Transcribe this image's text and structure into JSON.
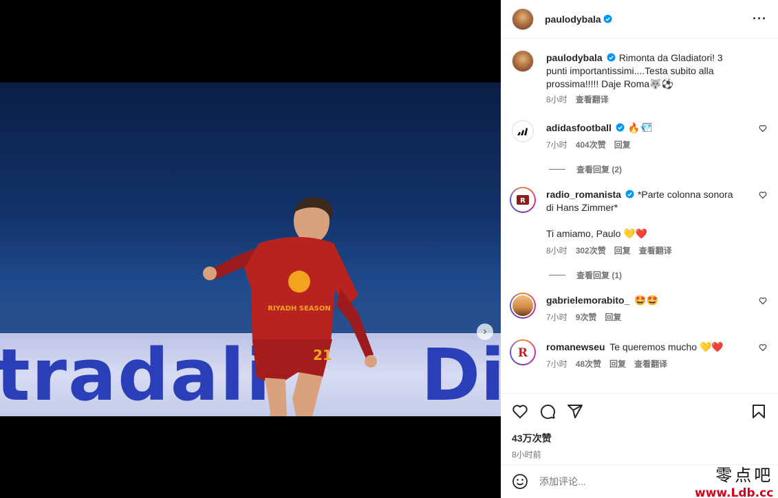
{
  "post": {
    "author": "paulodybala",
    "caption": "Rimonta da Gladiatori! 3 punti importantissimi....Testa subito alla prossima!!!!! Daje Roma🐺⚽",
    "time": "8小时",
    "translate": "查看翻译"
  },
  "photo": {
    "board_text": "tradali",
    "board_text_right": "Di",
    "shirt_number": "21",
    "sponsor": "RIYADH SEASON",
    "dots": 3,
    "active_dot": 0
  },
  "comments": [
    {
      "username": "adidasfootball",
      "verified": true,
      "text": "🔥💎⃞",
      "time": "7小时",
      "likes": "404次赞",
      "reply": "回复",
      "view_replies": "查看回复 (2)"
    },
    {
      "username": "radio_romanista",
      "verified": true,
      "text": "*Parte colonna sonora di Hans Zimmer*",
      "text2": "Ti amiamo, Paulo 💛❤️",
      "time": "8小时",
      "likes": "302次赞",
      "reply": "回复",
      "translate": "查看翻译",
      "view_replies": "查看回复 (1)"
    },
    {
      "username": "gabrielemorabito_",
      "verified": false,
      "text": "🤩🤩",
      "time": "7小时",
      "likes": "9次赞",
      "reply": "回复"
    },
    {
      "username": "romanewseu",
      "verified": false,
      "text": "Te queremos mucho 💛❤️",
      "time": "7小时",
      "likes": "48次赞",
      "reply": "回复",
      "translate": "查看翻译"
    }
  ],
  "footer": {
    "likes": "43万次赞",
    "posted": "8小时前",
    "comment_placeholder": "添加评论..."
  },
  "watermark": {
    "cn": "零点吧",
    "url": "www.Ldb.cc"
  },
  "colors": {
    "verified": "#0095f6",
    "meta_gray": "#737373",
    "text": "#262626"
  },
  "icons": [
    "more-icon",
    "heart-icon",
    "comment-icon",
    "share-icon",
    "save-icon",
    "emoji-icon",
    "chevron-right-icon",
    "verified-badge-icon"
  ]
}
